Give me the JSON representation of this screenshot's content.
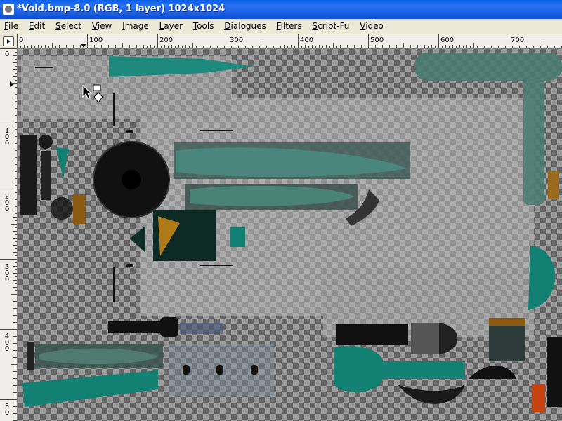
{
  "window": {
    "title": "*Void.bmp-8.0 (RGB, 1 layer) 1024x1024"
  },
  "menubar": {
    "items": [
      {
        "first": "F",
        "rest": "ile"
      },
      {
        "first": "E",
        "rest": "dit"
      },
      {
        "first": "S",
        "rest": "elect"
      },
      {
        "first": "V",
        "rest": "iew"
      },
      {
        "first": "I",
        "rest": "mage"
      },
      {
        "first": "L",
        "rest": "ayer"
      },
      {
        "first": "T",
        "rest": "ools"
      },
      {
        "first": "D",
        "rest": "ialogues"
      },
      {
        "first": "F",
        "rest": "ilters"
      },
      {
        "first": "S",
        "rest": "cript-Fu"
      },
      {
        "first": "V",
        "rest": "ideo"
      }
    ]
  },
  "rulers": {
    "top_labels": [
      "0",
      "100",
      "200",
      "300",
      "400",
      "500",
      "600",
      "700"
    ],
    "left_labels": [
      [
        "0"
      ],
      [
        "1",
        "0",
        "0"
      ],
      [
        "2",
        "0",
        "0"
      ],
      [
        "3",
        "0",
        "0"
      ],
      [
        "4",
        "0",
        "0"
      ],
      [
        "5",
        "0"
      ]
    ]
  },
  "colors": {
    "teal": "#1e8a7e",
    "dark_teal": "#0b6b62",
    "orange": "#c76a12",
    "brown": "#9b6b1d",
    "black": "#111111",
    "titlebar": "#1b5fe0"
  }
}
